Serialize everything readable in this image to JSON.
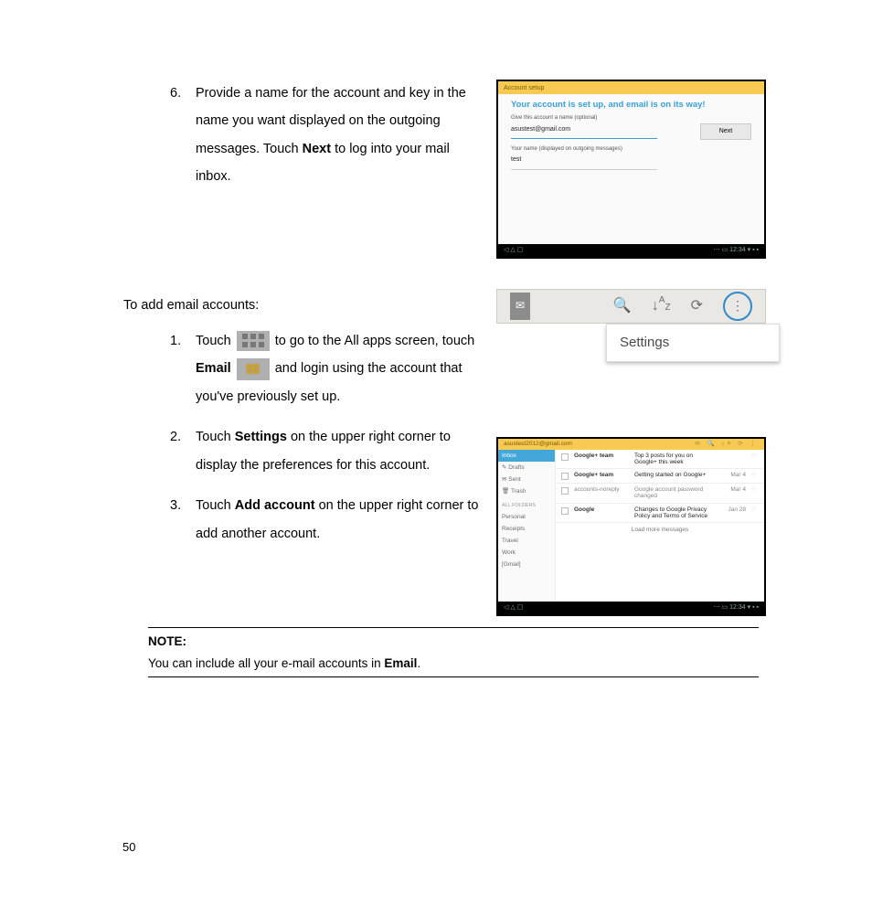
{
  "step6": {
    "num": "6.",
    "text_before_bold": "Provide a name for the account and key in the name you want displayed on the outgoing messages. Touch ",
    "bold": "Next",
    "text_after_bold": " to log into your mail inbox."
  },
  "intro": "To add email accounts:",
  "steps": {
    "s1": {
      "num": "1.",
      "t1": "Touch ",
      "t2": " to go to the All apps screen, touch ",
      "bold_email": "Email",
      "t3": " and login using the account that you've previously set up."
    },
    "s2": {
      "num": "2.",
      "t1": "Touch ",
      "bold": "Settings",
      "t2": " on the upper right corner to display the preferences for this account."
    },
    "s3": {
      "num": "3.",
      "t1": "Touch ",
      "bold": "Add account",
      "t2": " on the upper right corner to add another account."
    }
  },
  "note": {
    "title": "NOTE:",
    "body_before": "You can include all your e-mail accounts in ",
    "body_bold": "Email",
    "body_after": "."
  },
  "page_number": "50",
  "fig1": {
    "topbar": "Account setup",
    "headline": "Your account is set up, and email is on its way!",
    "label1": "Give this account a name (optional)",
    "val1": "asustest@gmail.com",
    "label2": "Your name (displayed on outgoing messages)",
    "val2": "test",
    "next": "Next",
    "nav_left": "◁  △  ▢",
    "nav_right": "⋯  ▭ 12:34 ▾ ▪ ▪"
  },
  "fig2": {
    "settings": "Settings"
  },
  "fig3": {
    "account": "asustest2012@gmail.com",
    "topicons": "✉  🔍  ↕≡  ⟳  ⋮",
    "sidebar": {
      "inbox": "Inbox",
      "drafts": "Drafts",
      "sent": "Sent",
      "trash": "Trash",
      "section": "ALL FOLDERS",
      "personal": "Personal",
      "receipts": "Receipts",
      "travel": "Travel",
      "work": "Work",
      "gmail": "[Gmail]"
    },
    "rows": [
      {
        "from": "Google+ team",
        "subj": "Top 3 posts for you on Google+ this week",
        "date": ""
      },
      {
        "from": "Google+ team",
        "subj": "Getting started on Google+",
        "date": "Mar 4"
      },
      {
        "from": "accounts-noreply",
        "subj": "Google account password changed",
        "date": "Mar 4"
      },
      {
        "from": "Google",
        "subj": "Changes to Google Privacy Policy and Terms of Service",
        "date": "Jan 28"
      }
    ],
    "loadmore": "Load more messages",
    "nav_left": "◁  △  ▢",
    "nav_right": "⋯  ▭ 12:34 ▾ ▪ ▪"
  }
}
